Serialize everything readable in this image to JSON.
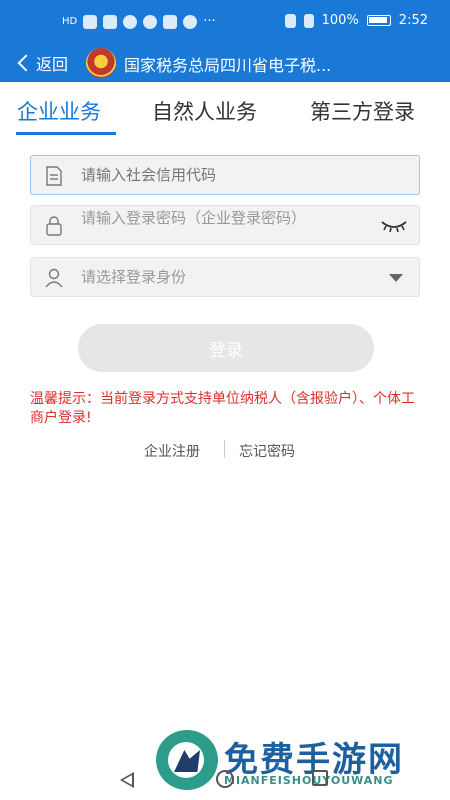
{
  "status_bar": {
    "left_text": "HD",
    "battery": "100%",
    "time": "2:52"
  },
  "nav": {
    "back_label": "返回",
    "title": "国家税务总局四川省电子税..."
  },
  "tabs": [
    {
      "label": "企业业务",
      "active": true
    },
    {
      "label": "自然人业务",
      "active": false
    },
    {
      "label": "第三方登录",
      "active": false
    }
  ],
  "form": {
    "credit_code_placeholder": "请输入社会信用代码",
    "password_placeholder": "请输入登录密码（企业登录密码）",
    "identity_placeholder": "请选择登录身份"
  },
  "login_button": "登录",
  "tip": "温馨提示：当前登录方式支持单位纳税人（含报验户）、个体工商户登录!",
  "links": {
    "register": "企业注册",
    "forgot": "忘记密码"
  },
  "watermark": {
    "big": "免费手游网",
    "small": "MIANFEISHOUYOUWANG"
  },
  "colors": {
    "primary": "#1a78d6",
    "tip_red": "#d9312c",
    "button_disabled": "#e6e6e6"
  }
}
